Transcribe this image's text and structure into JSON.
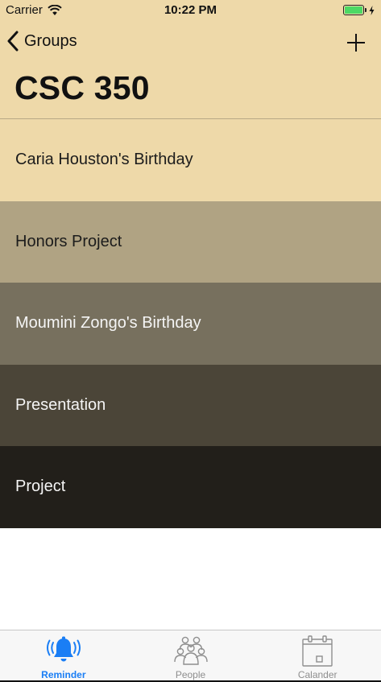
{
  "status_bar": {
    "carrier": "Carrier",
    "time": "10:22 PM",
    "battery_color": "#4cd964"
  },
  "nav": {
    "back_label": "Groups",
    "back_icon": "chevron-left-icon",
    "add_icon": "plus-icon"
  },
  "page": {
    "title": "CSC 350"
  },
  "items": [
    {
      "label": "Caria Houston's Birthday",
      "bg": "#eed9a9",
      "fg": "#1c1c1c"
    },
    {
      "label": "Honors Project",
      "bg": "#b0a383",
      "fg": "#1c1c1c"
    },
    {
      "label": "Moumini Zongo's Birthday",
      "bg": "#77705e",
      "fg": "#f5f5f5"
    },
    {
      "label": "Presentation",
      "bg": "#4b4538",
      "fg": "#f5f5f5"
    },
    {
      "label": "Project",
      "bg": "#221f1a",
      "fg": "#f5f5f5"
    }
  ],
  "tabs": [
    {
      "label": "Reminder",
      "icon": "bell-icon",
      "active": true
    },
    {
      "label": "People",
      "icon": "people-icon",
      "active": false
    },
    {
      "label": "Calander",
      "icon": "calendar-icon",
      "active": false
    }
  ],
  "colors": {
    "header_bg": "#eed9a9",
    "tab_active": "#1a7ef5",
    "tab_inactive": "#8e8e8e"
  }
}
